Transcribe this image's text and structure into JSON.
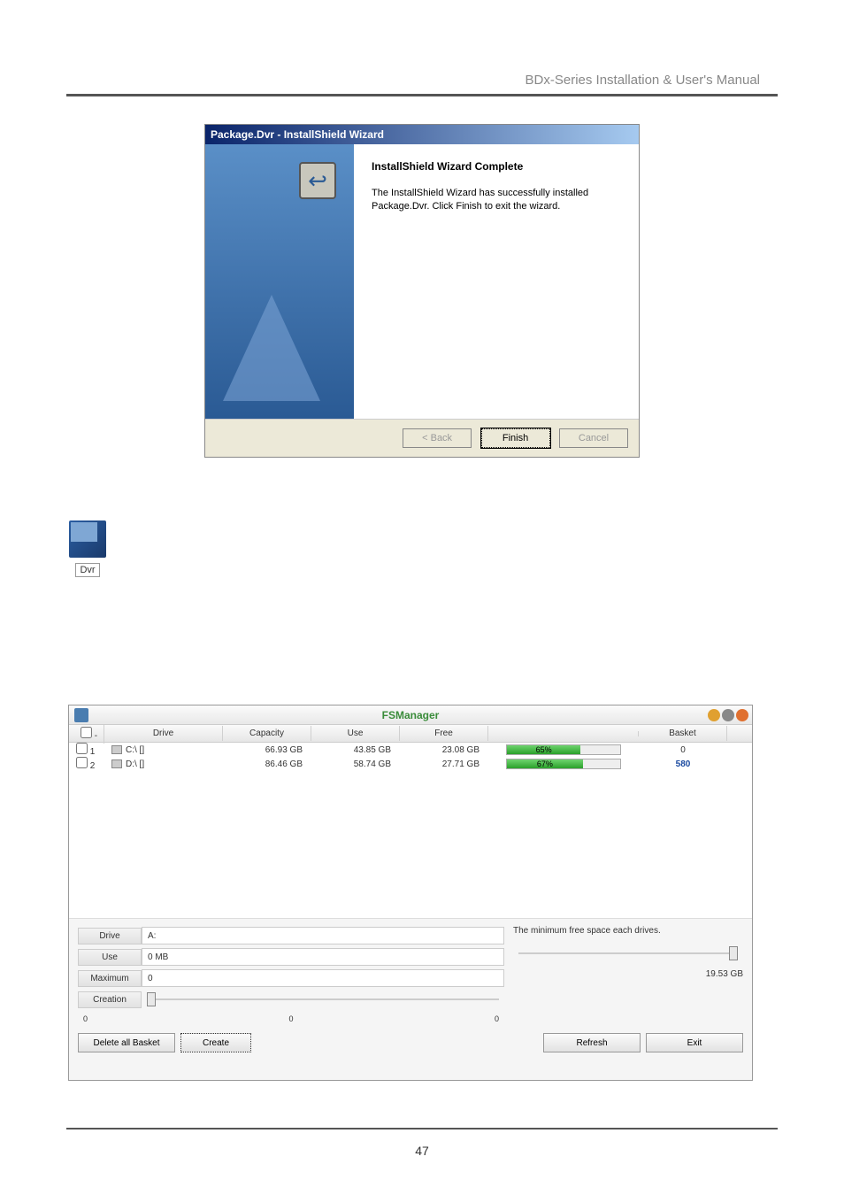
{
  "header": {
    "text": "BDx-Series Installation & User's Manual"
  },
  "dialog1": {
    "title": "Package.Dvr - InstallShield Wizard",
    "heading": "InstallShield Wizard Complete",
    "body": "The InstallShield Wizard has successfully installed Package.Dvr.  Click Finish to exit the wizard.",
    "back_label": "< Back",
    "finish_label": "Finish",
    "cancel_label": "Cancel"
  },
  "desktop_icon": {
    "label": "Dvr"
  },
  "dialog2": {
    "title": "FSManager",
    "columns": {
      "check": "-",
      "drive": "Drive",
      "capacity": "Capacity",
      "use": "Use",
      "free": "Free",
      "basket": "Basket"
    },
    "rows": [
      {
        "num": "1",
        "drive": "C:\\ []",
        "capacity": "66.93 GB",
        "use": "43.85 GB",
        "free": "23.08 GB",
        "pct": "65%",
        "pct_val": 65,
        "basket": "0",
        "basket_blue": false
      },
      {
        "num": "2",
        "drive": "D:\\ []",
        "capacity": "86.46 GB",
        "use": "58.74 GB",
        "free": "27.71 GB",
        "pct": "67%",
        "pct_val": 67,
        "basket": "580",
        "basket_blue": true
      }
    ],
    "lower": {
      "drive_label": "Drive",
      "drive_value": "A:",
      "use_label": "Use",
      "use_value": "0 MB",
      "maximum_label": "Maximum",
      "maximum_value": "0",
      "creation_label": "Creation",
      "tick0": "0",
      "tick1": "0",
      "tick2": "0",
      "min_free_label": "The minimum free space each drives.",
      "min_free_value": "19.53 GB"
    },
    "buttons": {
      "delete_all": "Delete all Basket",
      "create": "Create",
      "refresh": "Refresh",
      "exit": "Exit"
    }
  },
  "page_number": "47"
}
